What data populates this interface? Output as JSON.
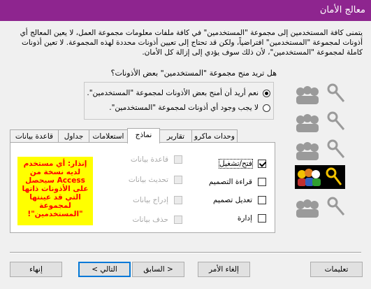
{
  "window": {
    "title": "معالج الأمان"
  },
  "intro": "يتمنى كافة المستخدمين إلى مجموعة \"المستخدمين\" في كافة ملفات معلومات مجموعة العمل، لا يعين المعالج أي أذونات لمجموعة \"المستخدمين\" افتراضياً، ولكن قد تحتاج إلى تعيين أذونات محددة لهذه المجموعة. لا تعين أذونات كاملة لمجموعة \"المستخدمين\"، لأن ذلك سوف يؤدي إلى إزالة كل الأمان.",
  "question": "هل تريد منح مجموعة \"المستخدمين\" بعض الأذونات؟",
  "options": {
    "yes": "نعم أريد أن أمنح بعض الأذونات لمجموعة \"المستخدمين\".",
    "no": "لا يجب وجود أي أذونات لمجموعة \"المستخدمين\"."
  },
  "tabs": [
    "وحدات ماكرو",
    "تقارير",
    "نماذج",
    "استعلامات",
    "جداول",
    "قاعدة بيانات"
  ],
  "permissions_left": [
    {
      "label": "قاعدة بيانات",
      "checked": false
    },
    {
      "label": "تحديث بيانات",
      "checked": false
    },
    {
      "label": "إدراج بيانات",
      "checked": false
    },
    {
      "label": "حذف بيانات",
      "checked": false
    }
  ],
  "permissions_right": [
    {
      "label": "فتح/تشغيل",
      "checked": true
    },
    {
      "label": "قراءة التصميم",
      "checked": false
    },
    {
      "label": "تعديل تصميم",
      "checked": false
    },
    {
      "label": "إدارة",
      "checked": false
    }
  ],
  "warning": "إنذار: أي مستخدم لديه نسخة من Access سيحصل على الأذونات ذاتها التي قد عينتها لمجموعة \"المستخدمين\"!",
  "buttons": {
    "help": "تعليمات",
    "cancel": "إلغاء الأمر",
    "back": "< السابق",
    "next": "التالي >",
    "finish": "إنهاء"
  },
  "colors": {
    "title_bar": "#8e258f",
    "warning_bg": "#ffff00",
    "warning_text": "#ff0000"
  },
  "icons": [
    "users-key-icon",
    "users-key-icon",
    "users-key-icon",
    "users-key-icon-selected",
    "users-key-icon"
  ]
}
